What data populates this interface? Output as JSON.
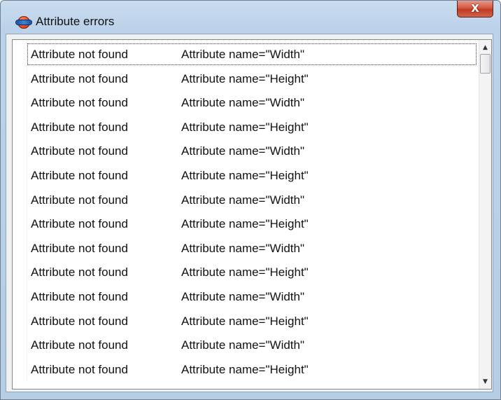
{
  "window": {
    "title": "Attribute errors",
    "close_glyph": "X",
    "icon": "app-sphere-icon"
  },
  "list": {
    "rows": [
      {
        "error": "Attribute not found",
        "detail": "Attribute name=\"Width\""
      },
      {
        "error": "Attribute not found",
        "detail": "Attribute name=\"Height\""
      },
      {
        "error": "Attribute not found",
        "detail": "Attribute name=\"Width\""
      },
      {
        "error": "Attribute not found",
        "detail": "Attribute name=\"Height\""
      },
      {
        "error": "Attribute not found",
        "detail": "Attribute name=\"Width\""
      },
      {
        "error": "Attribute not found",
        "detail": "Attribute name=\"Height\""
      },
      {
        "error": "Attribute not found",
        "detail": "Attribute name=\"Width\""
      },
      {
        "error": "Attribute not found",
        "detail": "Attribute name=\"Height\""
      },
      {
        "error": "Attribute not found",
        "detail": "Attribute name=\"Width\""
      },
      {
        "error": "Attribute not found",
        "detail": "Attribute name=\"Height\""
      },
      {
        "error": "Attribute not found",
        "detail": "Attribute name=\"Width\""
      },
      {
        "error": "Attribute not found",
        "detail": "Attribute name=\"Height\""
      },
      {
        "error": "Attribute not found",
        "detail": "Attribute name=\"Width\""
      },
      {
        "error": "Attribute not found",
        "detail": "Attribute name=\"Height\""
      }
    ],
    "focused_index": 0
  },
  "scrollbar": {
    "up_glyph": "▲",
    "down_glyph": "▼"
  }
}
